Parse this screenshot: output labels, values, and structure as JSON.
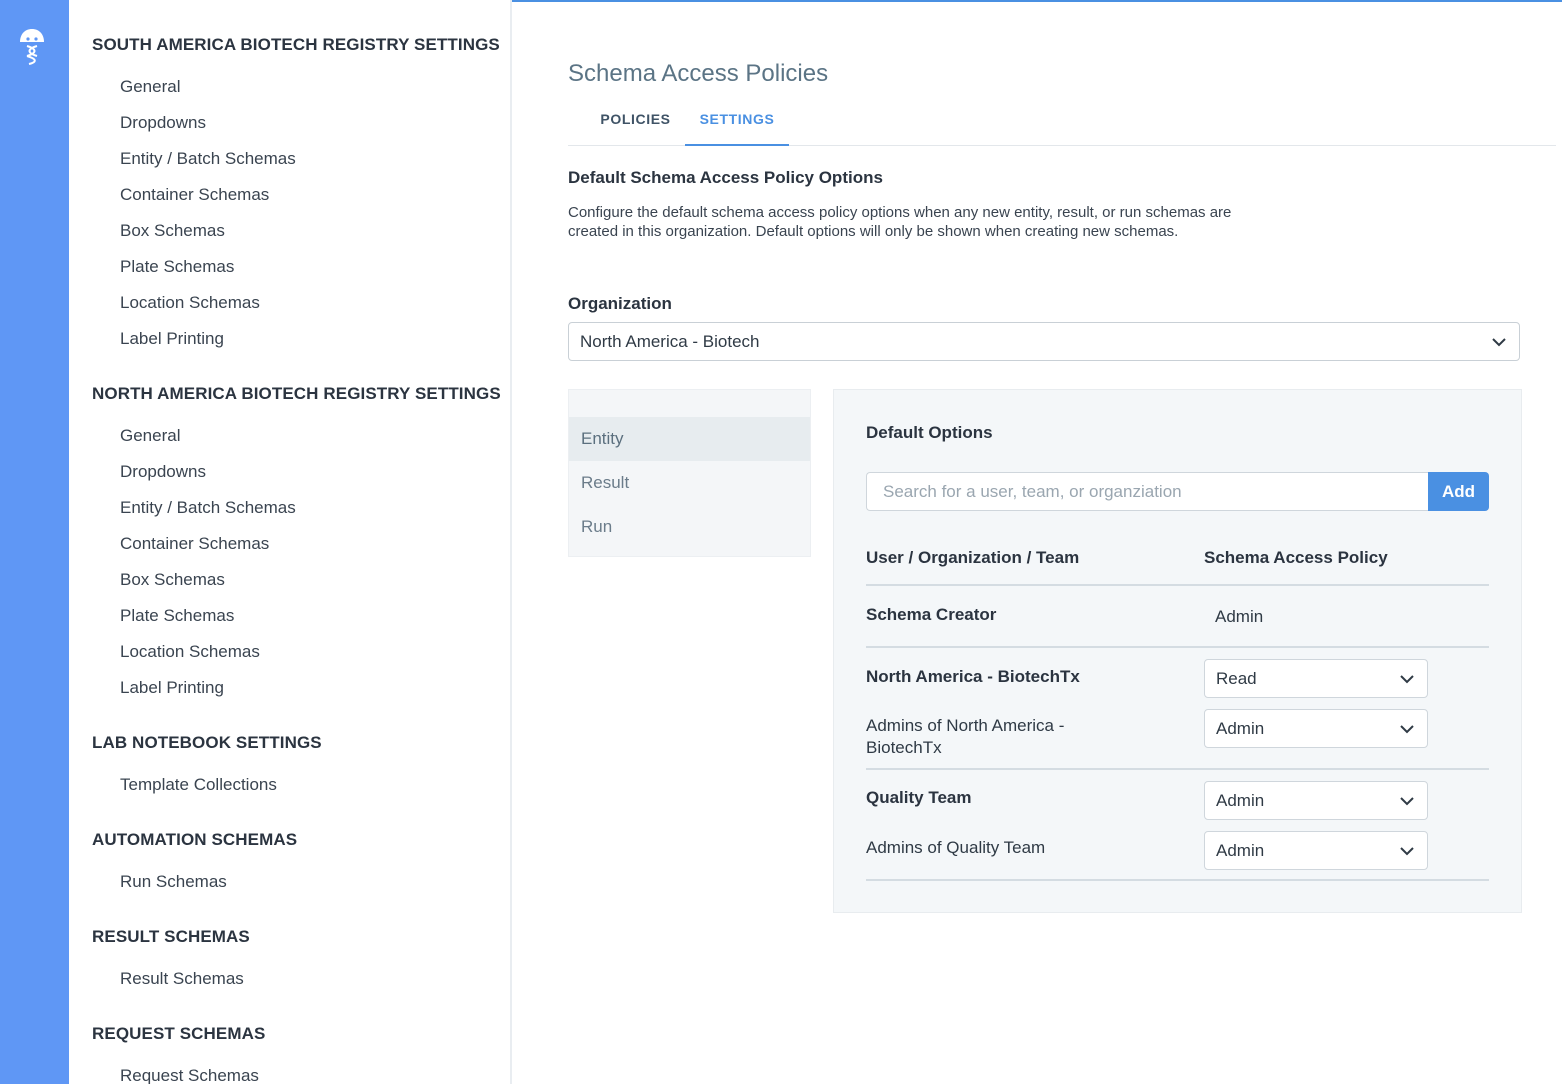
{
  "sidebar": {
    "sections": [
      {
        "title": "SOUTH AMERICA BIOTECH REGISTRY SETTINGS",
        "items": [
          "General",
          "Dropdowns",
          "Entity / Batch Schemas",
          "Container Schemas",
          "Box Schemas",
          "Plate Schemas",
          "Location Schemas",
          "Label Printing"
        ]
      },
      {
        "title": "NORTH AMERICA BIOTECH REGISTRY SETTINGS",
        "items": [
          "General",
          "Dropdowns",
          "Entity / Batch Schemas",
          "Container Schemas",
          "Box Schemas",
          "Plate Schemas",
          "Location Schemas",
          "Label Printing"
        ]
      },
      {
        "title": "LAB NOTEBOOK SETTINGS",
        "items": [
          "Template Collections"
        ]
      },
      {
        "title": "AUTOMATION SCHEMAS",
        "items": [
          "Run Schemas"
        ]
      },
      {
        "title": "RESULT SCHEMAS",
        "items": [
          "Result Schemas"
        ]
      },
      {
        "title": "REQUEST SCHEMAS",
        "items": [
          "Request Schemas"
        ]
      }
    ]
  },
  "page": {
    "title": "Schema Access Policies",
    "tabs": [
      {
        "label": "POLICIES",
        "active": false
      },
      {
        "label": "SETTINGS",
        "active": true
      }
    ],
    "heading": "Default Schema Access Policy Options",
    "description": "Configure the default schema access policy options when any new entity, result, or run schemas are created in this organization. Default options will only be shown when creating new schemas.",
    "organization": {
      "label": "Organization",
      "value": "North America - Biotech"
    },
    "types": [
      {
        "label": "Entity",
        "active": true
      },
      {
        "label": "Result",
        "active": false
      },
      {
        "label": "Run",
        "active": false
      }
    ]
  },
  "options": {
    "title": "Default Options",
    "search_placeholder": "Search for a user, team, or organziation",
    "add_label": "Add",
    "columns": {
      "who": "User / Organization / Team",
      "policy": "Schema Access Policy"
    },
    "rows": [
      {
        "name": "Schema Creator",
        "policy": "Admin"
      },
      {
        "name": "North America - BiotechTx",
        "policy": "Read"
      },
      {
        "name": "Admins of North America - BiotechTx",
        "policy": "Admin"
      },
      {
        "name": "Quality Team",
        "policy": "Admin"
      },
      {
        "name": "Admins of Quality Team",
        "policy": "Admin"
      }
    ]
  },
  "colors": {
    "rail": "#5f97f5",
    "accent": "#4a90e2",
    "panel": "#f4f7f9"
  },
  "icons": {
    "logo": "benchling-logo-icon",
    "dropdown": "chevron-down-icon"
  }
}
